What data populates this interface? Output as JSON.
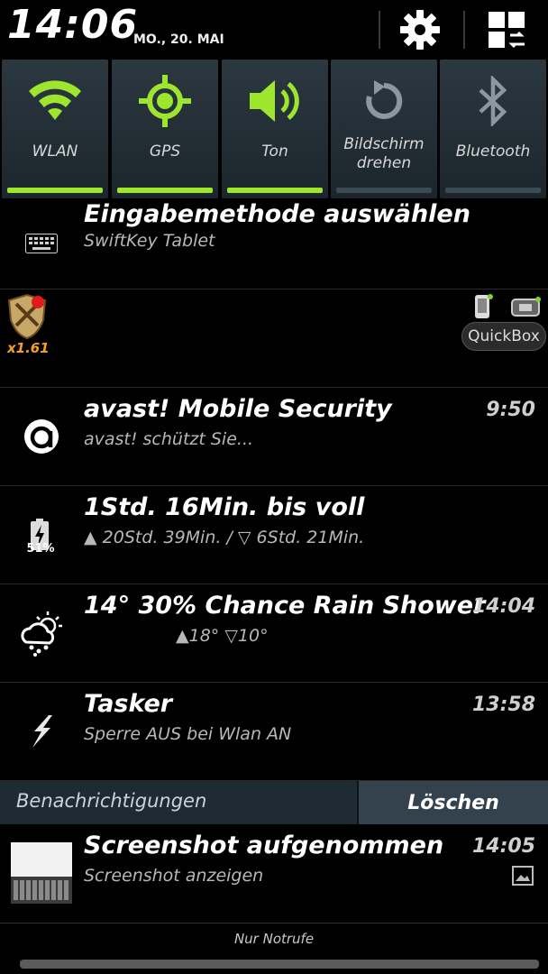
{
  "status": {
    "time": "14:06",
    "date": "MO., 20. MAI"
  },
  "header_icons": [
    "settings-icon",
    "view-switch-icon"
  ],
  "toggles": [
    {
      "label": "WLAN",
      "icon": "wifi-icon",
      "state": "on"
    },
    {
      "label": "GPS",
      "icon": "gps-icon",
      "state": "on"
    },
    {
      "label": "Ton",
      "icon": "speaker-icon",
      "state": "on"
    },
    {
      "label": "Bildschirm drehen",
      "icon": "rotate-icon",
      "state": "off"
    },
    {
      "label": "Bluetooth",
      "icon": "bluetooth-icon",
      "state": "off"
    }
  ],
  "notifications": {
    "input_method": {
      "title": "Eingabemethode auswählen",
      "subtitle": "SwiftKey Tablet",
      "icon": "keyboard-icon"
    },
    "quickbox": {
      "app_badge": "x1.61",
      "button_label": "QuickBox",
      "icon": "shield-app-icon"
    },
    "avast": {
      "title": "avast! Mobile Security",
      "subtitle": "avast! schützt Sie...",
      "time": "9:50",
      "icon": "avast-icon"
    },
    "battery": {
      "title": "1Std. 16Min. bis voll",
      "subtitle": "▲ 20Std. 39Min.  / ▽ 6Std. 21Min.",
      "percent": "51%",
      "icon": "battery-charging-icon"
    },
    "weather": {
      "title": "14° 30% Chance Rain Shower",
      "subtitle": "▲18° ▽10°",
      "time": "14:04",
      "icon": "weather-rain-icon"
    },
    "tasker": {
      "title": "Tasker",
      "subtitle": "Sperre AUS bei Wlan AN",
      "time": "13:58",
      "icon": "tasker-bolt-icon"
    },
    "screenshot": {
      "title": "Screenshot aufgenommen",
      "subtitle": "Screenshot anzeigen",
      "time": "14:05",
      "icon": "screenshot-thumbnail",
      "small_icon": "image-icon"
    }
  },
  "clear_bar": {
    "label": "Benachrichtigungen",
    "clear_button": "Löschen"
  },
  "footer": {
    "carrier": "Nur Notrufe"
  },
  "colors": {
    "accent_green": "#9ee62e",
    "toggle_bg": "#253139",
    "clear_bar_bg": "#1f2b33"
  }
}
